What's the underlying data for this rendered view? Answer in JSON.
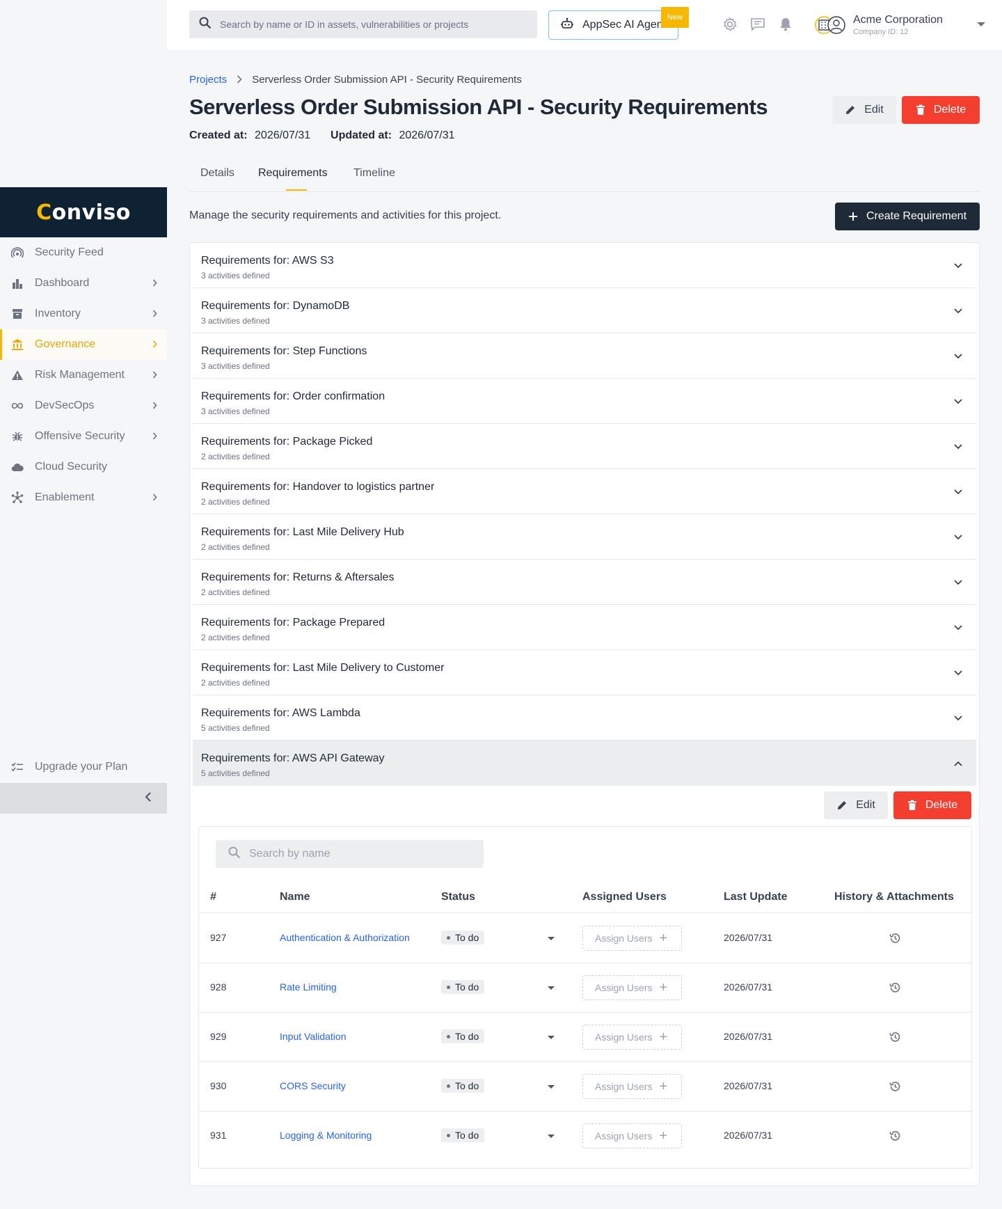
{
  "sidebar": {
    "logo": "Conviso",
    "items": [
      {
        "label": "Security Feed",
        "icon": "broadcast-icon",
        "chevron": false,
        "active": false
      },
      {
        "label": "Dashboard",
        "icon": "bar-chart-icon",
        "chevron": true,
        "active": false
      },
      {
        "label": "Inventory",
        "icon": "archive-icon",
        "chevron": true,
        "active": false
      },
      {
        "label": "Governance",
        "icon": "bank-icon",
        "chevron": true,
        "active": true
      },
      {
        "label": "Risk Management",
        "icon": "warning-icon",
        "chevron": true,
        "active": false
      },
      {
        "label": "DevSecOps",
        "icon": "infinity-icon",
        "chevron": true,
        "active": false
      },
      {
        "label": "Offensive Security",
        "icon": "bug-icon",
        "chevron": true,
        "active": false
      },
      {
        "label": "Cloud Security",
        "icon": "cloud-icon",
        "chevron": false,
        "active": false
      },
      {
        "label": "Enablement",
        "icon": "hub-icon",
        "chevron": true,
        "active": false
      }
    ],
    "upgrade_label": "Upgrade your Plan"
  },
  "topbar": {
    "search_placeholder": "Search by name or ID in assets, vulnerabilities or projects",
    "ai_label": "AppSec AI Agent",
    "new_badge": "New",
    "company_name": "Acme Corporation",
    "company_id": "Company ID: 12"
  },
  "page": {
    "breadcrumb_root": "Projects",
    "breadcrumb_current": "Serverless Order Submission API - Security Requirements",
    "title": "Serverless Order Submission API - Security Requirements",
    "created_label": "Created at:",
    "created_value": "2026/07/31",
    "updated_label": "Updated at:",
    "updated_value": "2026/07/31",
    "edit_label": "Edit",
    "delete_label": "Delete",
    "tabs": [
      "Details",
      "Requirements",
      "Timeline"
    ],
    "active_tab": "Requirements",
    "description": "Manage the security requirements and activities for this project.",
    "create_label": "Create Requirement"
  },
  "requirements": [
    {
      "title": "Requirements for: AWS S3",
      "count": "3 activities defined"
    },
    {
      "title": "Requirements for: DynamoDB",
      "count": "3 activities defined"
    },
    {
      "title": "Requirements for: Step Functions",
      "count": "3 activities defined"
    },
    {
      "title": "Requirements for: Order confirmation",
      "count": "3 activities defined"
    },
    {
      "title": "Requirements for: Package Picked",
      "count": "2 activities defined"
    },
    {
      "title": "Requirements for: Handover to logistics partner",
      "count": "2 activities defined"
    },
    {
      "title": "Requirements for: Last Mile Delivery Hub",
      "count": "2 activities defined"
    },
    {
      "title": "Requirements for: Returns & Aftersales",
      "count": "2 activities defined"
    },
    {
      "title": "Requirements for: Package Prepared",
      "count": "2 activities defined"
    },
    {
      "title": "Requirements for: Last Mile Delivery to Customer",
      "count": "2 activities defined"
    },
    {
      "title": "Requirements for: AWS Lambda",
      "count": "5 activities defined"
    },
    {
      "title": "Requirements for: AWS API Gateway",
      "count": "5 activities defined"
    }
  ],
  "activities": {
    "edit_label": "Edit",
    "delete_label": "Delete",
    "search_placeholder": "Search by name",
    "columns": {
      "id": "#",
      "name": "Name",
      "status": "Status",
      "assigned": "Assigned Users",
      "updated": "Last Update",
      "history": "History & Attachments"
    },
    "assign_label": "Assign Users",
    "rows": [
      {
        "id": "927",
        "name": "Authentication & Authorization",
        "status": "To do",
        "updated": "2026/07/31"
      },
      {
        "id": "928",
        "name": "Rate Limiting",
        "status": "To do",
        "updated": "2026/07/31"
      },
      {
        "id": "929",
        "name": "Input Validation",
        "status": "To do",
        "updated": "2026/07/31"
      },
      {
        "id": "930",
        "name": "CORS Security",
        "status": "To do",
        "updated": "2026/07/31"
      },
      {
        "id": "931",
        "name": "Logging & Monitoring",
        "status": "To do",
        "updated": "2026/07/31"
      }
    ]
  },
  "colors": {
    "accent": "#f5b700",
    "link": "#2563eb",
    "danger": "#f43f30",
    "dark": "#1f2a38",
    "logo_bg": "#0f2233"
  }
}
